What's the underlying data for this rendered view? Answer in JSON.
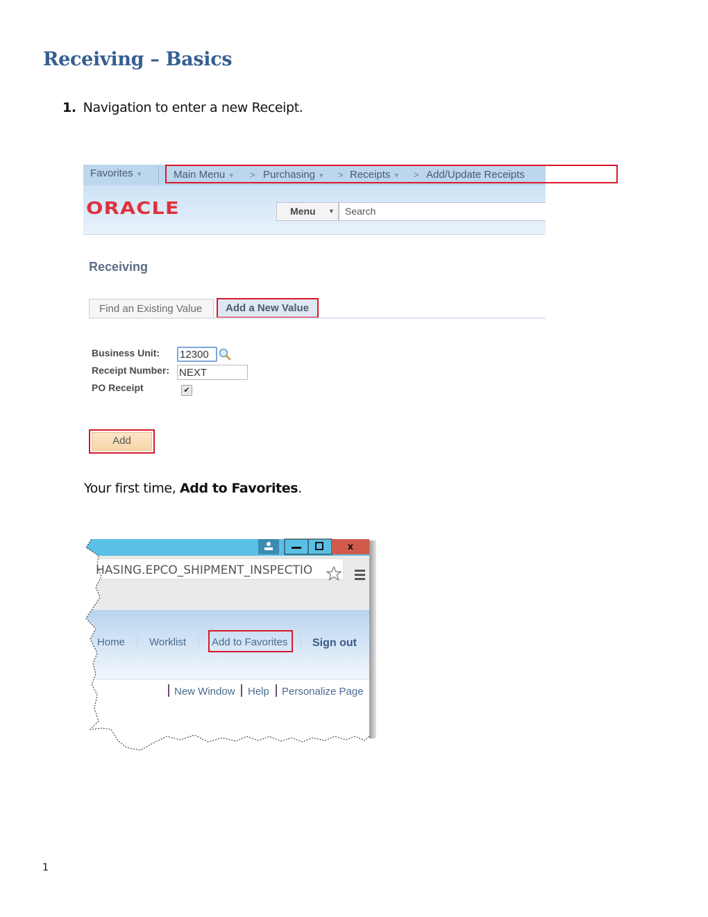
{
  "document": {
    "title": "Receiving – Basics",
    "step1": {
      "number": "1.",
      "text": "Navigation to enter a new Receipt."
    },
    "para2": {
      "prefix": "Your first time, ",
      "bold": "Add to Favorites",
      "suffix": "."
    },
    "page_number": "1"
  },
  "screenshot1": {
    "navbar": {
      "favorites": "Favorites",
      "breadcrumbs": [
        "Main Menu",
        "Purchasing",
        "Receipts",
        "Add/Update Receipts"
      ]
    },
    "logo": "ORACLE",
    "menu_label": "Menu",
    "search_placeholder": "Search",
    "page_title": "Receiving",
    "tabs": [
      {
        "label": "Find an Existing Value",
        "active": false
      },
      {
        "label": "Add a New Value",
        "active": true
      }
    ],
    "form": {
      "business_unit_label": "Business Unit:",
      "business_unit_value": "12300",
      "receipt_number_label": "Receipt Number:",
      "receipt_number_value": "NEXT",
      "po_receipt_label": "PO Receipt",
      "po_receipt_checked": true
    },
    "add_button": "Add",
    "highlight_color": "#d7192a"
  },
  "screenshot2": {
    "url_fragment": "HASING.EPCO_SHIPMENT_INSPECTIO",
    "window_controls": [
      "user",
      "minimize",
      "restore",
      "close"
    ],
    "header_links": [
      "Home",
      "Worklist",
      "Add to Favorites",
      "Sign out"
    ],
    "page_links": [
      "New Window",
      "Help",
      "Personalize Page"
    ],
    "highlighted_link": "Add to Favorites"
  }
}
